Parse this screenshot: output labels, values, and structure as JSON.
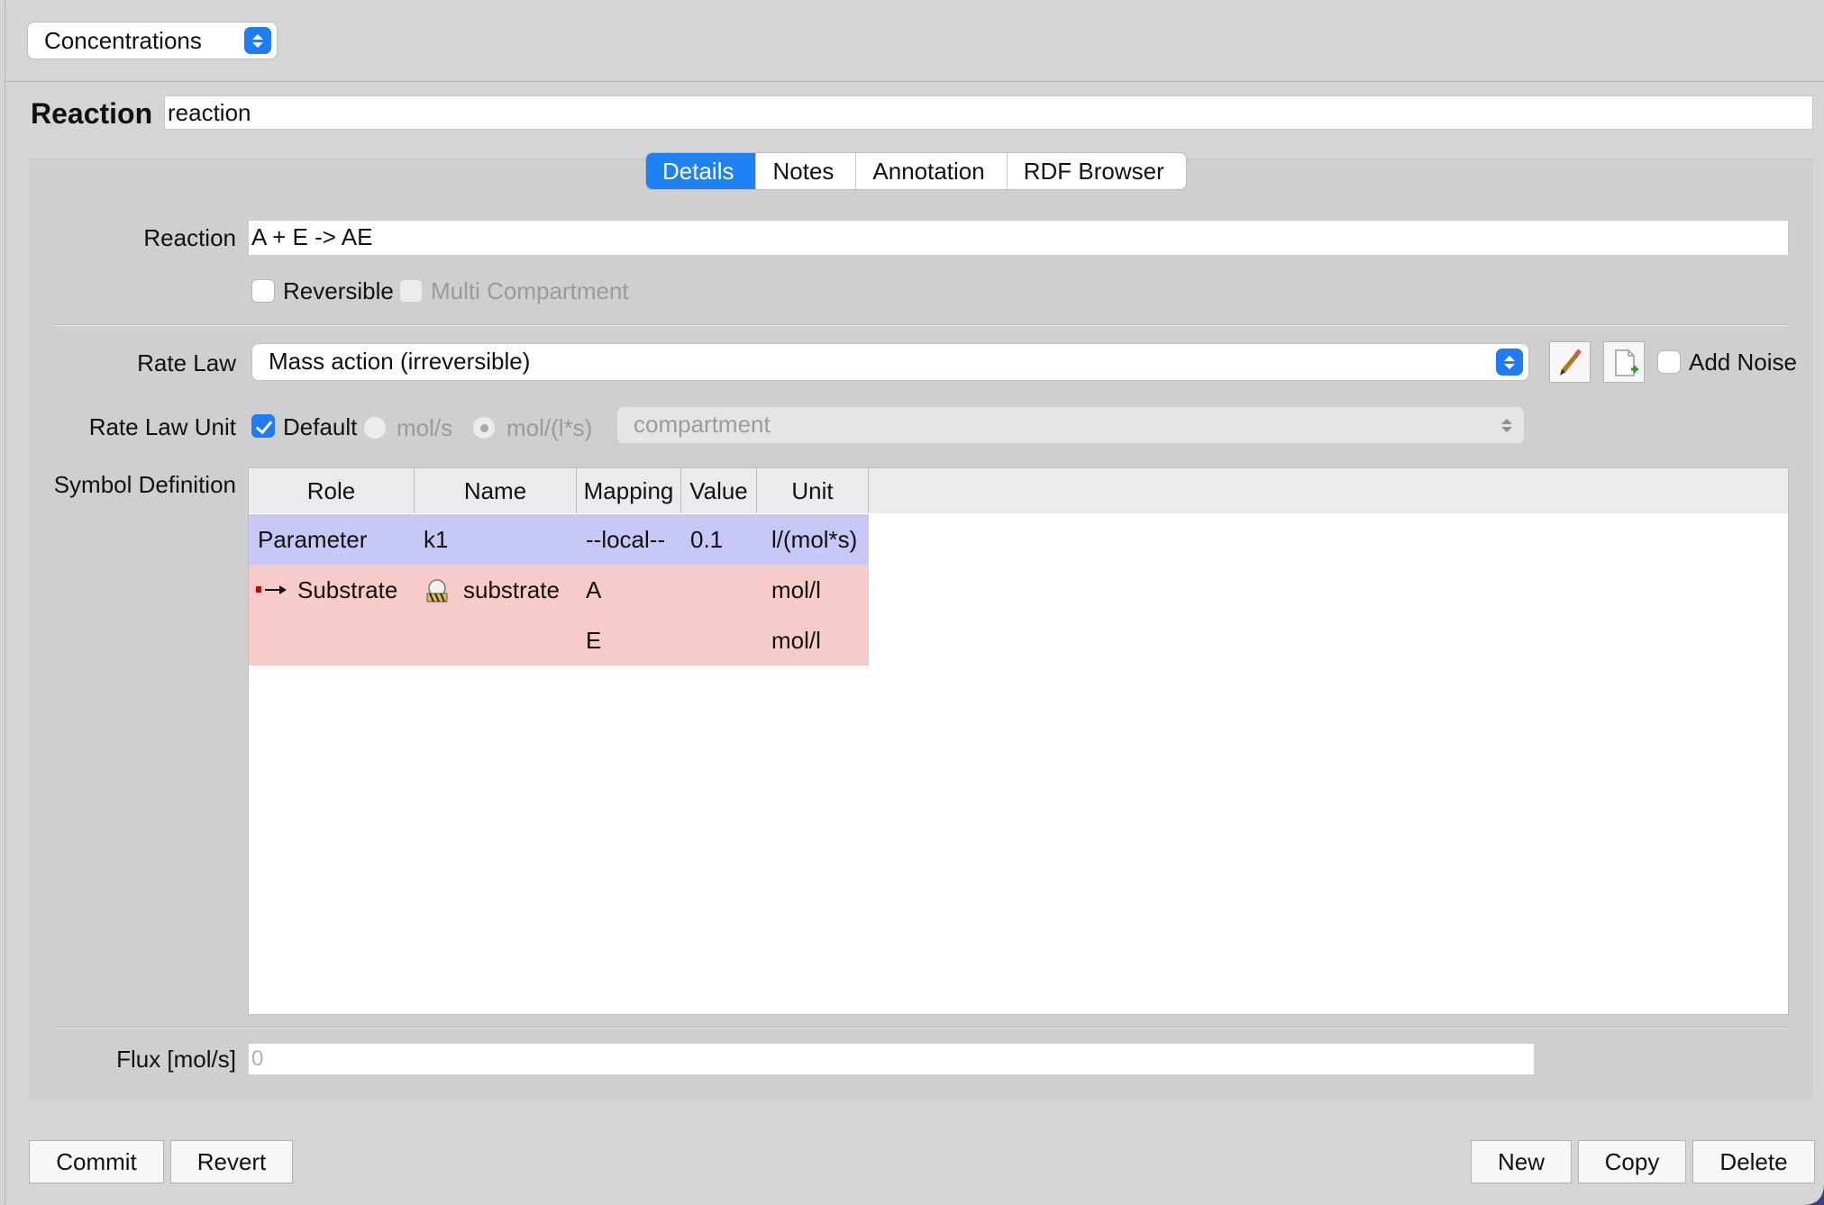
{
  "top_select": {
    "value": "Concentrations"
  },
  "header": {
    "title": "Reaction",
    "name_value": "reaction"
  },
  "tabs": [
    {
      "label": "Details"
    },
    {
      "label": "Notes"
    },
    {
      "label": "Annotation"
    },
    {
      "label": "RDF Browser"
    }
  ],
  "details": {
    "reaction_label": "Reaction",
    "reaction_equation": "A + E -> AE",
    "reversible_label": "Reversible",
    "reversible_checked": false,
    "multi_compartment_label": "Multi Compartment",
    "rate_law_label": "Rate Law",
    "rate_law_value": "Mass action (irreversible)",
    "add_noise_label": "Add Noise",
    "rate_law_unit_label": "Rate Law Unit",
    "default_label": "Default",
    "default_checked": true,
    "unit_mol_s": "mol/s",
    "unit_mol_ls": "mol/(l*s)",
    "compartment_placeholder": "compartment",
    "symbol_definition_label": "Symbol Definition",
    "flux_label": "Flux [mol/s]",
    "flux_value": "0"
  },
  "table": {
    "columns": [
      "Role",
      "Name",
      "Mapping",
      "Value",
      "Unit"
    ],
    "rows": [
      {
        "role": "Parameter",
        "name": "k1",
        "mapping": "--local--",
        "value": "0.1",
        "unit": "l/(mol*s)"
      },
      {
        "role": "Substrate",
        "name": "substrate",
        "mapping": "A",
        "value": "",
        "unit": "mol/l"
      },
      {
        "role": "",
        "name": "",
        "mapping": "E",
        "value": "",
        "unit": "mol/l"
      }
    ]
  },
  "buttons": {
    "commit": "Commit",
    "revert": "Revert",
    "new": "New",
    "copy": "Copy",
    "delete": "Delete"
  },
  "icons": {
    "edit": "pencil-icon",
    "new_function": "new-document-icon",
    "substrate_role": "arrow-right-icon",
    "substrate_species": "species-icon"
  },
  "colors": {
    "accent": "#1f82f2",
    "parameter_row": "#c8c8f7",
    "substrate_row": "#f8cbcb"
  }
}
